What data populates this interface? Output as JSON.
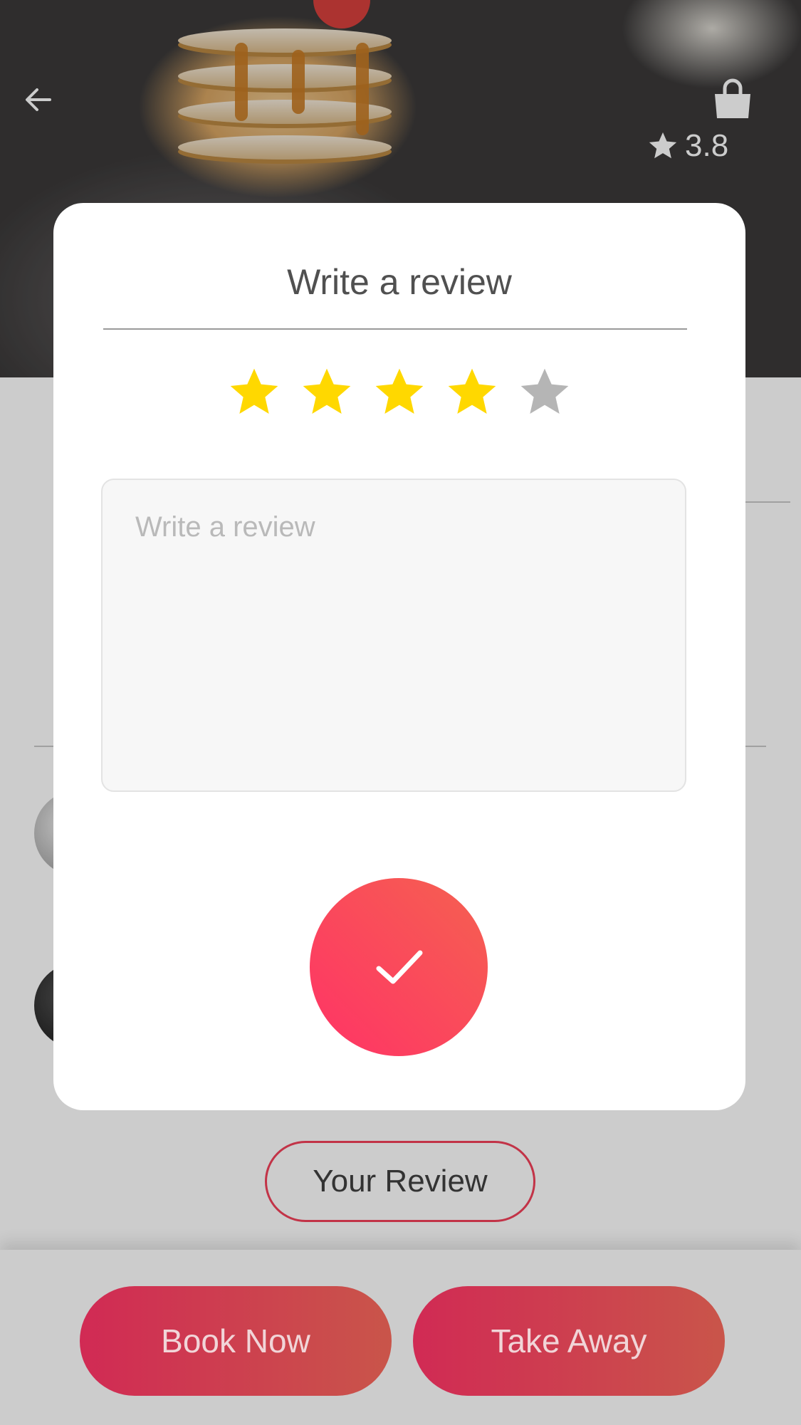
{
  "header": {
    "back_icon": "arrow-left-icon",
    "bag_icon": "shopping-bag-icon",
    "rating_value": "3.8"
  },
  "modal": {
    "title": "Write a review",
    "rating": {
      "selected": 4,
      "max": 5
    },
    "review_placeholder": "Write a review",
    "submit_icon": "check-icon"
  },
  "your_review_label": "Your Review",
  "actions": {
    "book_now": "Book Now",
    "take_away": "Take Away"
  },
  "colors": {
    "accent": "#ff3366",
    "star_active": "#ffd800",
    "star_inactive": "#b5b5b5"
  }
}
